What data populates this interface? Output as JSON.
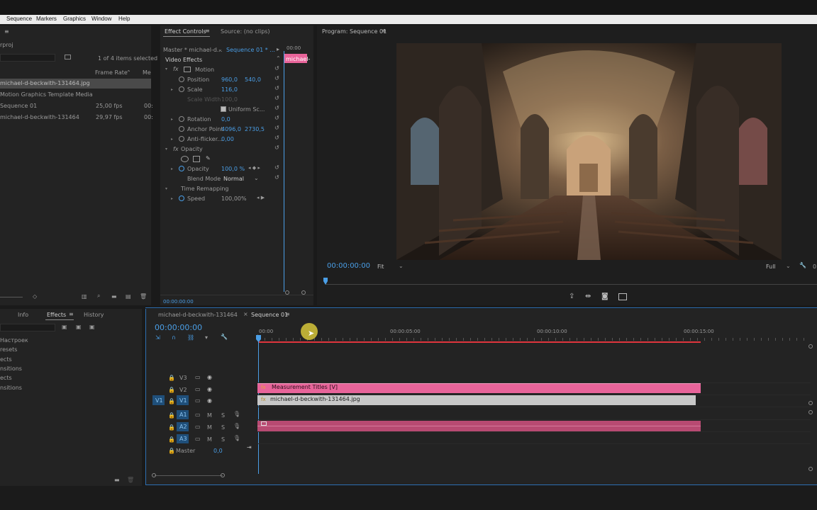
{
  "menu": {
    "items": [
      "Sequence",
      "Markers",
      "Graphics",
      "Window",
      "Help"
    ]
  },
  "project": {
    "file_fragment": "rproj",
    "items_selected": "1 of 4 items selected",
    "col_frame_rate": "Frame Rate",
    "col_media": "Me",
    "rows": [
      {
        "name": "michael-d-beckwith-131464.jpg",
        "fps": "",
        "extra": ""
      },
      {
        "name": "Motion Graphics Template Media",
        "fps": "",
        "extra": ""
      },
      {
        "name": "Sequence 01",
        "fps": "25,00 fps",
        "extra": "00:"
      },
      {
        "name": "michael-d-beckwith-131464",
        "fps": "29,97 fps",
        "extra": "00:"
      }
    ]
  },
  "effect_controls": {
    "tab_label": "Effect Controls",
    "source_tab": "Source: (no clips)",
    "master_label": "Master * michael-d...",
    "sequence_label": "Sequence 01 * ...",
    "mini_timecode": "00:00",
    "mini_clip": "michael-",
    "video_effects": "Video Effects",
    "motion": "Motion",
    "position_label": "Position",
    "position_x": "960,0",
    "position_y": "540,0",
    "scale_label": "Scale",
    "scale_value": "116,0",
    "scale_width_label": "Scale Width",
    "scale_width_value": "100,0",
    "uniform_scale": "Uniform Sc...",
    "rotation_label": "Rotation",
    "rotation_value": "0,0",
    "anchor_label": "Anchor Point",
    "anchor_x": "4096,0",
    "anchor_y": "2730,5",
    "antiflicker_label": "Anti-flicker...",
    "antiflicker_value": "0,00",
    "opacity_section": "Opacity",
    "opacity_label": "Opacity",
    "opacity_value": "100,0 %",
    "blend_label": "Blend Mode",
    "blend_value": "Normal",
    "time_remap": "Time Remapping",
    "speed_label": "Speed",
    "speed_value": "100,00%",
    "bottom_timecode": "00:00:00:00"
  },
  "program": {
    "title": "Program: Sequence 01",
    "timecode": "00:00:00:00",
    "fit": "Fit",
    "quality": "Full",
    "right_fragment": "0"
  },
  "effects_panel": {
    "tabs": [
      "Info",
      "Effects",
      "History"
    ],
    "items": [
      "Настроек",
      "resets",
      "ects",
      "nsitions",
      "ects",
      "nsitions"
    ]
  },
  "timeline": {
    "tab_inactive": "michael-d-beckwith-131464",
    "tab_active": "Sequence 01",
    "timecode": "00:00:00:00",
    "ruler_labels": [
      "00:00",
      "00:00:05:00",
      "00:00:10:00",
      "00:00:15:00"
    ],
    "video_tracks": [
      "V3",
      "V2",
      "V1"
    ],
    "audio_tracks": [
      "A1",
      "A2",
      "A3"
    ],
    "source_patch": "V1",
    "master_label": "Master",
    "master_value": "0,0",
    "clip_titles": "Measurement Titles [V]",
    "clip_image": "michael-d-beckwith-131464.jpg",
    "mute": "M",
    "solo": "S"
  },
  "colors": {
    "accent_blue": "#4a9ee6",
    "clip_pink": "#e8649a",
    "clip_gray": "#c8c8c8",
    "audio_clip": "#b84a72",
    "playhead_red": "#e0353d",
    "cursor_yellow": "#d6c63a"
  }
}
